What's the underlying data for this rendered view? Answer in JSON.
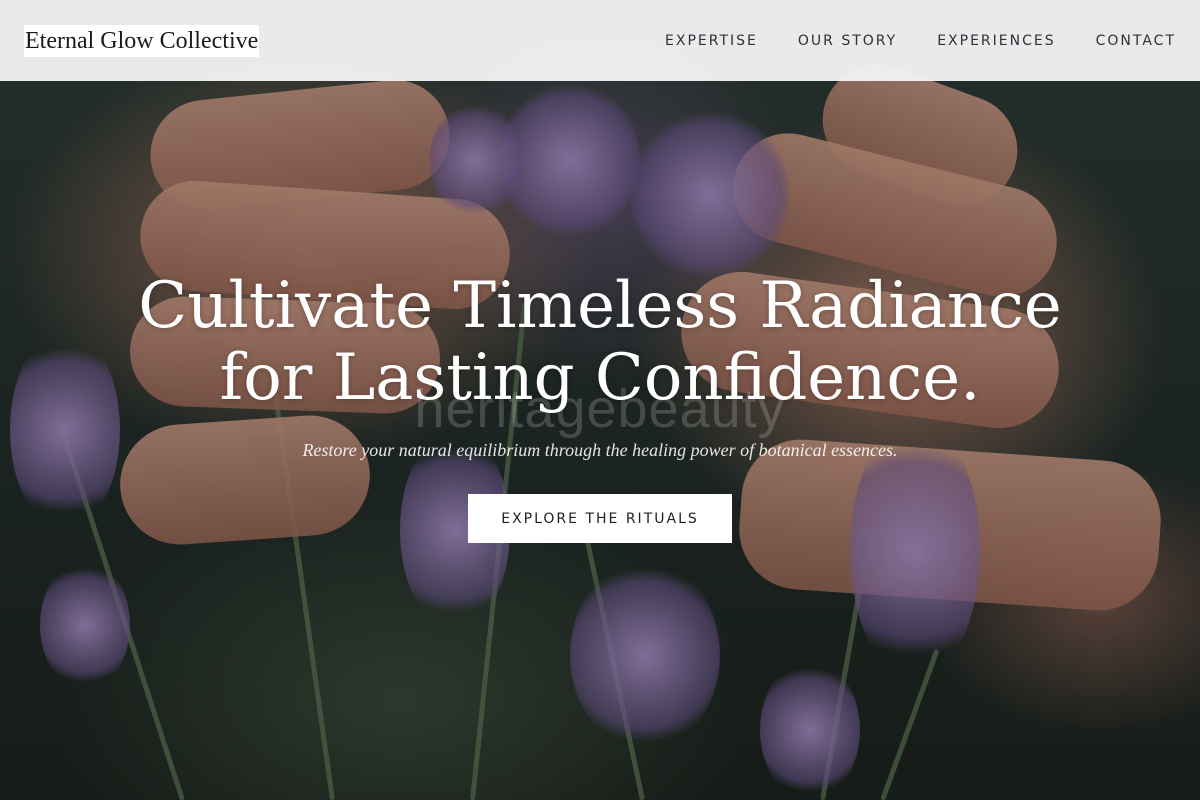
{
  "brand": {
    "name": "Eternal Glow Collective"
  },
  "nav": {
    "items": [
      {
        "label": "EXPERTISE"
      },
      {
        "label": "OUR STORY"
      },
      {
        "label": "EXPERIENCES"
      },
      {
        "label": "CONTACT"
      }
    ]
  },
  "hero": {
    "background_image": "hands-cupping-lavender-photo",
    "watermark": "heritagebeauty",
    "headline_line1": "Cultivate Timeless Radiance",
    "headline_line2": "for Lasting Confidence.",
    "subtitle": "Restore your natural equilibrium through the healing power of botanical essences.",
    "cta_label": "EXPLORE THE RITUALS"
  },
  "colors": {
    "nav_background": "#f1f3f4",
    "text_light": "#ffffff",
    "nav_text": "#2e3135",
    "lavender": "#a896cc"
  }
}
